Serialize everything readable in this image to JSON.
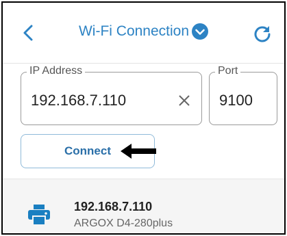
{
  "header": {
    "title": "Wi-Fi Connection",
    "icons": {
      "back": "back-chevron-icon",
      "dropdown": "dropdown-caret-icon",
      "refresh": "refresh-icon"
    }
  },
  "form": {
    "ip_label": "IP Address",
    "ip_value": "192.168.7.110",
    "port_label": "Port",
    "port_value": "9100",
    "connect_label": "Connect"
  },
  "devices": [
    {
      "ip": "192.168.7.110",
      "name": "ARGOX D4-280plus",
      "icon": "printer-icon"
    }
  ],
  "colors": {
    "accent": "#2d83c4",
    "button_text": "#2a6fa8",
    "printer": "#1a7fc1"
  }
}
